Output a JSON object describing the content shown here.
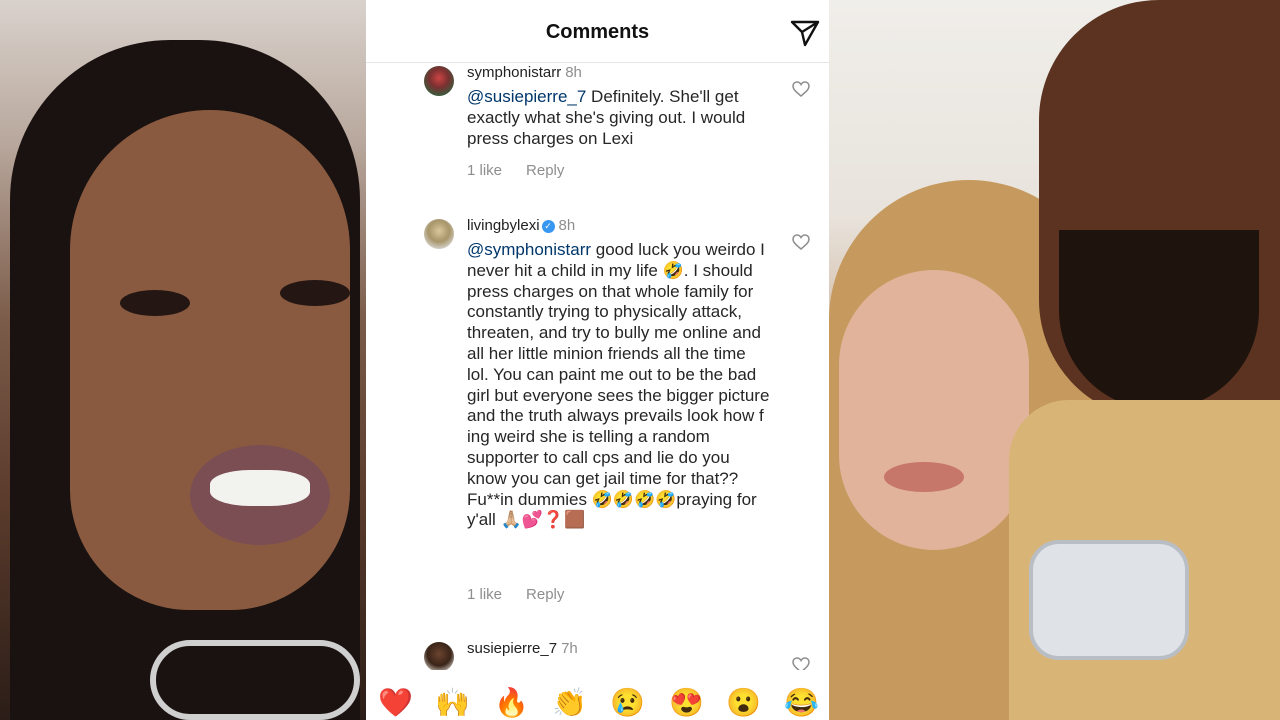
{
  "header": {
    "title": "Comments",
    "share_icon": "paper-plane-icon"
  },
  "comments": [
    {
      "username": "symphonistarr",
      "time": "8h",
      "mention": "@susiepierre_7",
      "text": " Definitely. She'll get exactly what she's giving out. I would press charges on Lexi",
      "likes": "1 like",
      "reply": "Reply",
      "verified": false
    },
    {
      "username": "livingbylexi",
      "time": "8h",
      "mention": "@symphonistarr",
      "text": " good luck you weirdo I never hit a child in my life 🤣. I should press charges on that whole family for constantly trying to physically attack, threaten, and try to bully me online and all her little minion friends all the time lol. You can paint me out to be the bad girl but everyone sees the bigger picture and the truth always prevails look how f ing weird she is telling a random supporter to call cps and lie do you know you can get jail time for that?? Fu**in dummies 🤣🤣🤣🤣praying for y'all 🙏🏼💕❓🟫",
      "likes": "1 like",
      "reply": "Reply",
      "verified": true
    },
    {
      "username": "susiepierre_7",
      "time": "7h",
      "mention": "",
      "text": "",
      "verified": false
    }
  ],
  "emoji_bar": [
    "❤️",
    "🙌",
    "🔥",
    "👏",
    "😢",
    "😍",
    "😮",
    "😂"
  ],
  "colors": {
    "accent_link": "#00376b",
    "verified": "#3897f0",
    "meta_gray": "#8e8e8e"
  }
}
